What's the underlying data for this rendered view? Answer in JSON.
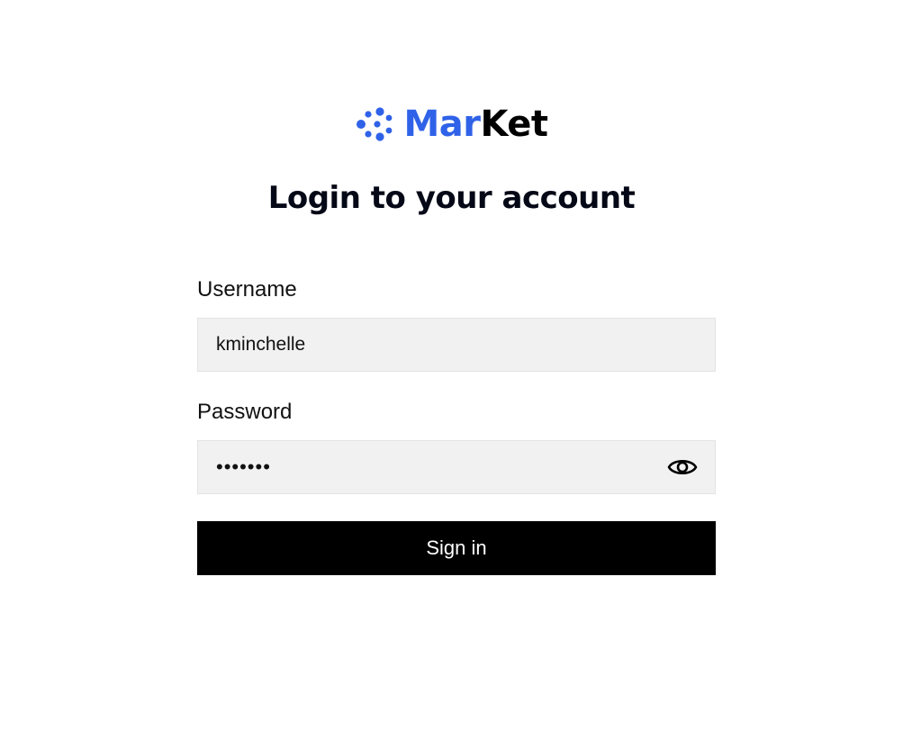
{
  "brand": {
    "name_accent": "Mar",
    "name_rest": "Ket",
    "icon": "dots-cluster-logo-icon",
    "accent_color": "#2f62e8"
  },
  "title": "Login to your account",
  "form": {
    "username": {
      "label": "Username",
      "value": "kminchelle"
    },
    "password": {
      "label": "Password",
      "value": "•••••••",
      "toggle_icon": "eye-icon"
    },
    "submit_label": "Sign in"
  },
  "colors": {
    "button_bg": "#000000",
    "field_bg": "#f1f1f1"
  }
}
